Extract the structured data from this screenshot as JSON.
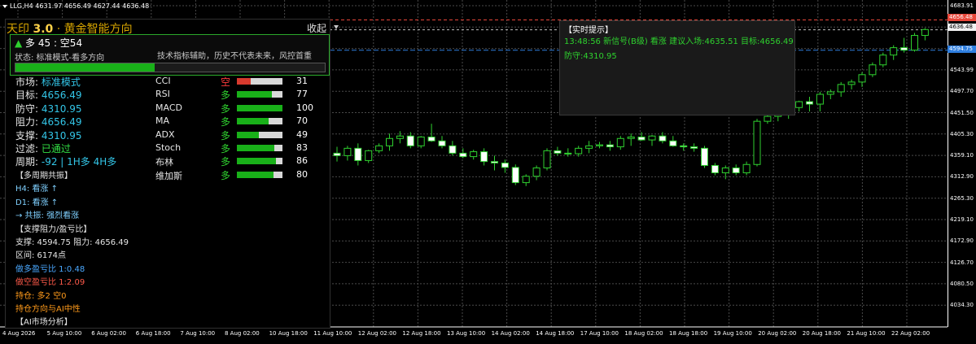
{
  "symbol_bar": {
    "text": "LLG,H4  4631.97 4656.49 4627.44 4636.48"
  },
  "panel": {
    "title_prefix": "天印 ",
    "version": "3.0",
    "title_suffix": " · 黄金智能方向",
    "collapse_label": "收起",
    "trend_arrow": "▲",
    "trend_text": " 多 45 : 空54",
    "status_text": "状态: 标准模式-看多方向",
    "disclaimer": "技术指标辅助，历史不代表未来，风控首重",
    "progress": 0.45,
    "rows": [
      {
        "key": "市场:",
        "value": "标准模式",
        "cls": "v"
      },
      {
        "key": "目标:",
        "value": "4656.49",
        "cls": "v"
      },
      {
        "key": "防守:",
        "value": "4310.95",
        "cls": "v"
      },
      {
        "key": "阻力:",
        "value": "4656.49",
        "cls": "v"
      },
      {
        "key": "支撑:",
        "value": "4310.95",
        "cls": "v"
      },
      {
        "key": "过滤:",
        "value": "已通过",
        "cls": "vg"
      },
      {
        "key": "周期:",
        "value": "-92 | 1H多 4H多",
        "cls": "v"
      }
    ],
    "indicators": [
      {
        "name": "CCI",
        "dir": "空",
        "dir_color": "#ff3b3b",
        "level": 0.31,
        "bar_color": "#d83a2e",
        "value": "31"
      },
      {
        "name": "RSI",
        "dir": "多",
        "dir_color": "#2fd12f",
        "level": 0.77,
        "bar_color": "#19b019",
        "value": "77"
      },
      {
        "name": "MACD",
        "dir": "多",
        "dir_color": "#2fd12f",
        "level": 1.0,
        "bar_color": "#19b019",
        "value": "100"
      },
      {
        "name": "MA",
        "dir": "多",
        "dir_color": "#2fd12f",
        "level": 0.7,
        "bar_color": "#19b019",
        "value": "70"
      },
      {
        "name": "ADX",
        "dir": "多",
        "dir_color": "#2fd12f",
        "level": 0.49,
        "bar_color": "#19b019",
        "value": "49"
      },
      {
        "name": "Stoch",
        "dir": "多",
        "dir_color": "#2fd12f",
        "level": 0.83,
        "bar_color": "#19b019",
        "value": "83"
      },
      {
        "name": "布林",
        "dir": "多",
        "dir_color": "#2fd12f",
        "level": 0.86,
        "bar_color": "#19b019",
        "value": "86"
      },
      {
        "name": "维加斯",
        "dir": "多",
        "dir_color": "#2fd12f",
        "level": 0.8,
        "bar_color": "#19b019",
        "value": "80"
      }
    ],
    "lines": [
      {
        "text": "【多周期共振】",
        "color": "#e6e6e6"
      },
      {
        "text": "H4: 看涨 ↑",
        "color": "#7fd0ff"
      },
      {
        "text": "D1: 看涨 ↑",
        "color": "#7fd0ff"
      },
      {
        "text": "→ 共振: 强烈看涨",
        "color": "#7fd0ff"
      },
      {
        "text": "【支撑阻力/盈亏比】",
        "color": "#e6e6e6"
      },
      {
        "text": "支撑: 4594.75  阻力: 4656.49",
        "color": "#e6e6e6"
      },
      {
        "text": "区间: 6174点",
        "color": "#e6e6e6"
      },
      {
        "text": "做多盈亏比 1:0.48",
        "color": "#4aa8ff"
      },
      {
        "text": "做空盈亏比 1:2.09",
        "color": "#ff5a4a"
      },
      {
        "text": "持仓: 多2 空0",
        "color": "#ff9a1a"
      },
      {
        "text": "持仓方向与AI中性",
        "color": "#ff9a1a"
      },
      {
        "text": "【AI市场分析】",
        "color": "#e6e6e6"
      }
    ]
  },
  "popup": {
    "title": "【实时提示】",
    "line1": "13:48:56 新信号(B级) 看涨 建议入场:4635.51 目标:4656.49",
    "line2": "防守:4310.95"
  },
  "price_axis": {
    "labels": [
      "4683.91",
      "4637.89",
      "4590.99",
      "4543.99",
      "4497.70",
      "4451.50",
      "4405.30",
      "4359.10",
      "4312.90",
      "4265.30",
      "4219.10",
      "4172.90",
      "4126.70",
      "4080.50",
      "4034.30"
    ],
    "tag_red": "4656.48",
    "tag_white": "4636.48",
    "tag_blue": "4594.75"
  },
  "time_axis": {
    "labels": [
      "4 Aug 2026",
      "5 Aug 10:00",
      "6 Aug 02:00",
      "6 Aug 18:00",
      "7 Aug 10:00",
      "8 Aug 02:00",
      "10 Aug 18:00",
      "11 Aug 10:00",
      "12 Aug 02:00",
      "12 Aug 18:00",
      "13 Aug 10:00",
      "14 Aug 02:00",
      "14 Aug 18:00",
      "17 Aug 10:00",
      "18 Aug 02:00",
      "18 Aug 18:00",
      "19 Aug 10:00",
      "20 Aug 02:00",
      "20 Aug 18:00",
      "21 Aug 10:00",
      "22 Aug 02:00"
    ]
  },
  "chart_data": {
    "type": "candlestick",
    "price_range": [
      4034.3,
      4683.91
    ],
    "levels": {
      "resistance": 4656.48,
      "current": 4636.48,
      "support": 4594.75
    },
    "candles": [
      [
        4385,
        4398,
        4368,
        4380
      ],
      [
        4380,
        4400,
        4370,
        4395
      ],
      [
        4395,
        4405,
        4360,
        4370
      ],
      [
        4370,
        4392,
        4365,
        4390
      ],
      [
        4390,
        4405,
        4385,
        4400
      ],
      [
        4400,
        4425,
        4390,
        4415
      ],
      [
        4415,
        4430,
        4405,
        4420
      ],
      [
        4420,
        4428,
        4395,
        4400
      ],
      [
        4400,
        4420,
        4395,
        4418
      ],
      [
        4418,
        4445,
        4408,
        4410
      ],
      [
        4410,
        4420,
        4395,
        4400
      ],
      [
        4400,
        4410,
        4380,
        4385
      ],
      [
        4385,
        4395,
        4375,
        4378
      ],
      [
        4378,
        4392,
        4372,
        4388
      ],
      [
        4388,
        4395,
        4360,
        4368
      ],
      [
        4368,
        4380,
        4350,
        4365
      ],
      [
        4365,
        4372,
        4345,
        4356
      ],
      [
        4356,
        4362,
        4320,
        4325
      ],
      [
        4325,
        4342,
        4318,
        4338
      ],
      [
        4338,
        4360,
        4330,
        4355
      ],
      [
        4355,
        4395,
        4350,
        4390
      ],
      [
        4390,
        4398,
        4380,
        4385
      ],
      [
        4385,
        4395,
        4378,
        4384
      ],
      [
        4384,
        4400,
        4378,
        4395
      ],
      [
        4395,
        4410,
        4385,
        4400
      ],
      [
        4400,
        4408,
        4395,
        4402
      ],
      [
        4402,
        4410,
        4390,
        4398
      ],
      [
        4398,
        4420,
        4392,
        4415
      ],
      [
        4415,
        4425,
        4400,
        4418
      ],
      [
        4418,
        4428,
        4410,
        4412
      ],
      [
        4412,
        4422,
        4400,
        4420
      ],
      [
        4420,
        4428,
        4405,
        4410
      ],
      [
        4410,
        4420,
        4398,
        4400
      ],
      [
        4400,
        4405,
        4390,
        4398
      ],
      [
        4398,
        4405,
        4388,
        4395
      ],
      [
        4395,
        4400,
        4355,
        4360
      ],
      [
        4360,
        4365,
        4340,
        4345
      ],
      [
        4345,
        4360,
        4332,
        4355
      ],
      [
        4355,
        4362,
        4340,
        4345
      ],
      [
        4345,
        4368,
        4340,
        4362
      ],
      [
        4362,
        4455,
        4358,
        4450
      ],
      [
        4450,
        4470,
        4445,
        4460
      ],
      [
        4460,
        4475,
        4450,
        4468
      ],
      [
        4468,
        4480,
        4455,
        4478
      ],
      [
        4478,
        4492,
        4470,
        4490
      ],
      [
        4490,
        4500,
        4470,
        4485
      ],
      [
        4485,
        4510,
        4470,
        4505
      ],
      [
        4505,
        4515,
        4495,
        4510
      ],
      [
        4510,
        4530,
        4500,
        4525
      ],
      [
        4525,
        4535,
        4515,
        4530
      ],
      [
        4530,
        4550,
        4520,
        4545
      ],
      [
        4545,
        4570,
        4540,
        4565
      ],
      [
        4565,
        4590,
        4560,
        4585
      ],
      [
        4585,
        4605,
        4575,
        4600
      ],
      [
        4600,
        4620,
        4590,
        4595
      ],
      [
        4595,
        4630,
        4592,
        4625
      ],
      [
        4625,
        4640,
        4615,
        4637
      ]
    ]
  }
}
